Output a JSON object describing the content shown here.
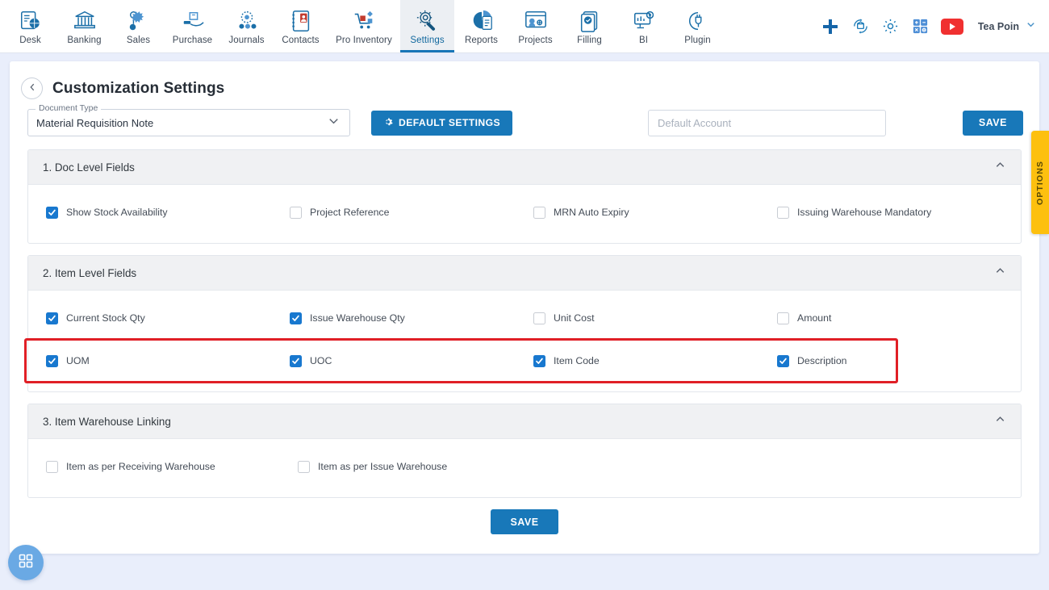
{
  "topnav": {
    "items": [
      {
        "label": "Desk",
        "icon": "desk-icon"
      },
      {
        "label": "Banking",
        "icon": "bank-icon"
      },
      {
        "label": "Sales",
        "icon": "sales-icon"
      },
      {
        "label": "Purchase",
        "icon": "purchase-icon"
      },
      {
        "label": "Journals",
        "icon": "journals-icon"
      },
      {
        "label": "Contacts",
        "icon": "contacts-icon"
      },
      {
        "label": "Pro Inventory",
        "icon": "inventory-icon"
      },
      {
        "label": "Settings",
        "icon": "settings-icon"
      },
      {
        "label": "Reports",
        "icon": "reports-icon"
      },
      {
        "label": "Projects",
        "icon": "projects-icon"
      },
      {
        "label": "Filling",
        "icon": "filling-icon"
      },
      {
        "label": "BI",
        "icon": "bi-icon"
      },
      {
        "label": "Plugin",
        "icon": "plugin-icon"
      }
    ],
    "active": "Settings",
    "right_icons": [
      "plus-icon",
      "refresh-bank-icon",
      "gear-icon",
      "calculator-icon",
      "youtube-icon"
    ],
    "user_name": "Tea Poin"
  },
  "header": {
    "back_icon": "chevron-left-icon",
    "title": "Customization Settings"
  },
  "controls": {
    "doc_type_label": "Document Type",
    "doc_type_value": "Material Requisition Note",
    "doc_type_chevron": "chevron-down-icon",
    "default_settings_label": "DEFAULT SETTINGS",
    "default_settings_icon": "gear-icon",
    "default_account_placeholder": "Default Account",
    "default_account_value": "",
    "save_top_label": "SAVE"
  },
  "options_tab": {
    "label": "OPTIONS"
  },
  "sections": [
    {
      "title": "1. Doc Level Fields",
      "chevron": "chevron-up-icon",
      "rows": [
        [
          {
            "label": "Show Stock Availability",
            "checked": true
          },
          {
            "label": "Project Reference",
            "checked": false
          },
          {
            "label": "MRN Auto Expiry",
            "checked": false
          },
          {
            "label": "Issuing Warehouse Mandatory",
            "checked": false
          }
        ]
      ]
    },
    {
      "title": "2. Item Level Fields",
      "chevron": "chevron-up-icon",
      "rows": [
        [
          {
            "label": "Current Stock Qty",
            "checked": true
          },
          {
            "label": "Issue Warehouse Qty",
            "checked": true
          },
          {
            "label": "Unit Cost",
            "checked": false
          },
          {
            "label": "Amount",
            "checked": false
          }
        ],
        [
          {
            "label": "UOM",
            "checked": true
          },
          {
            "label": "UOC",
            "checked": true
          },
          {
            "label": "Item Code",
            "checked": true
          },
          {
            "label": "Description",
            "checked": true
          }
        ]
      ],
      "highlight_row": 1
    },
    {
      "title": "3. Item Warehouse Linking",
      "chevron": "chevron-up-icon",
      "rows": [
        [
          {
            "label": "Item as per Receiving Warehouse",
            "checked": false
          },
          {
            "label": "Item as per Issue Warehouse",
            "checked": false
          }
        ]
      ]
    }
  ],
  "footer": {
    "save_label": "SAVE"
  },
  "fab": {
    "icon": "grid-apps-icon"
  },
  "colors": {
    "accent": "#1878b9",
    "checkbox_on": "#1878cf",
    "options_tab": "#fdc00f",
    "highlight": "#e01f26",
    "page_bg": "#e9eefb"
  }
}
